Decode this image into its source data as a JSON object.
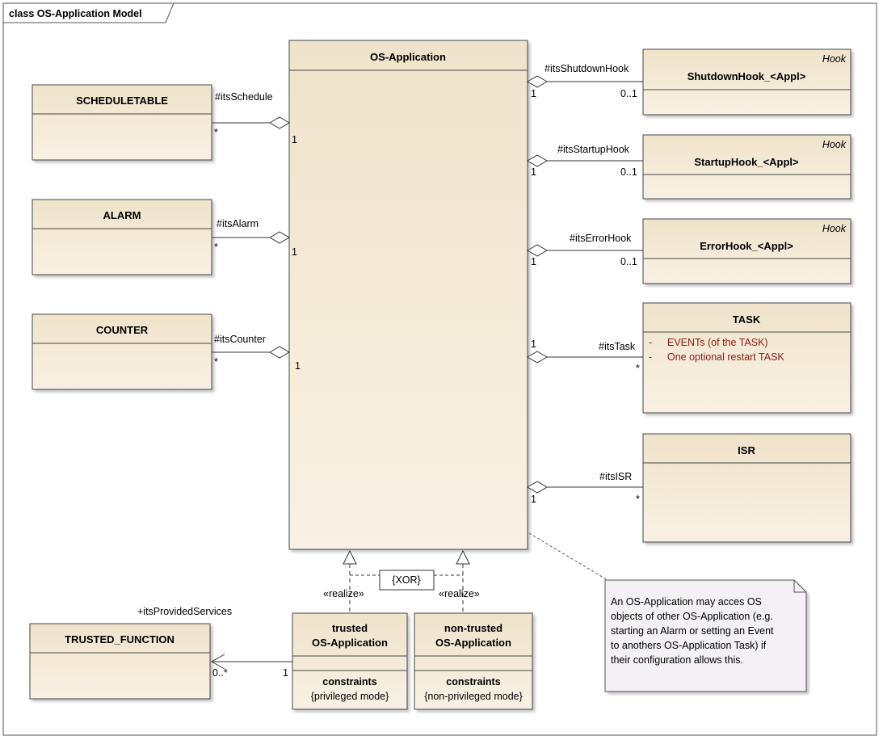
{
  "frame": {
    "title": "class OS-Application Model"
  },
  "classes": {
    "os_application": {
      "name": "OS-Application"
    },
    "scheduletable": {
      "name": "SCHEDULETABLE"
    },
    "alarm": {
      "name": "ALARM"
    },
    "counter": {
      "name": "COUNTER"
    },
    "shutdown_hook": {
      "name": "ShutdownHook_<Appl>",
      "stereotype": "Hook"
    },
    "startup_hook": {
      "name": "StartupHook_<Appl>",
      "stereotype": "Hook"
    },
    "error_hook": {
      "name": "ErrorHook_<Appl>",
      "stereotype": "Hook"
    },
    "task": {
      "name": "TASK",
      "attributes": [
        "EVENTs (of the TASK)",
        "One optional restart TASK"
      ],
      "bullet": "-"
    },
    "isr": {
      "name": "ISR"
    },
    "trusted_function": {
      "name": "TRUSTED_FUNCTION"
    },
    "trusted_app": {
      "name_line1": "trusted",
      "name_line2": "OS-Application",
      "section": "constraints",
      "constraint": "{privileged mode}"
    },
    "nontrusted_app": {
      "name_line1": "non-trusted",
      "name_line2": "OS-Application",
      "section": "constraints",
      "constraint": "{non-privileged mode}"
    }
  },
  "associations": {
    "schedule": {
      "role": "#itsSchedule",
      "near_mult": "*",
      "far_mult": "1"
    },
    "alarm": {
      "role": "#itsAlarm",
      "near_mult": "*",
      "far_mult": "1"
    },
    "counter": {
      "role": "#itsCounter",
      "near_mult": "*",
      "far_mult": "1"
    },
    "shutdown": {
      "role": "#itsShutdownHook",
      "near_mult": "1",
      "far_mult": "0..1"
    },
    "startup": {
      "role": "#itsStartupHook",
      "near_mult": "1",
      "far_mult": "0..1"
    },
    "error": {
      "role": "#itsErrorHook",
      "near_mult": "1",
      "far_mult": "0..1"
    },
    "task": {
      "role": "#itsTask",
      "near_mult": "1",
      "far_mult": "*"
    },
    "isr": {
      "role": "#itsISR",
      "near_mult": "1",
      "far_mult": "*"
    },
    "provided": {
      "role": "+itsProvidedServices",
      "near_mult": "1",
      "far_mult": "0..*"
    }
  },
  "realizations": {
    "label": "«realize»",
    "constraint": "{XOR}"
  },
  "note": {
    "lines": [
      "An OS-Application may acces OS",
      "objects of other OS-Application (e.g.",
      "starting an Alarm or setting an Event",
      "to anothers OS-Application Task) if",
      "their configuration allows this."
    ]
  },
  "colors": {
    "class_fill": "#f3e8d4",
    "note_fill": "#f4f0f6",
    "text_red": "#8b1a1a"
  }
}
